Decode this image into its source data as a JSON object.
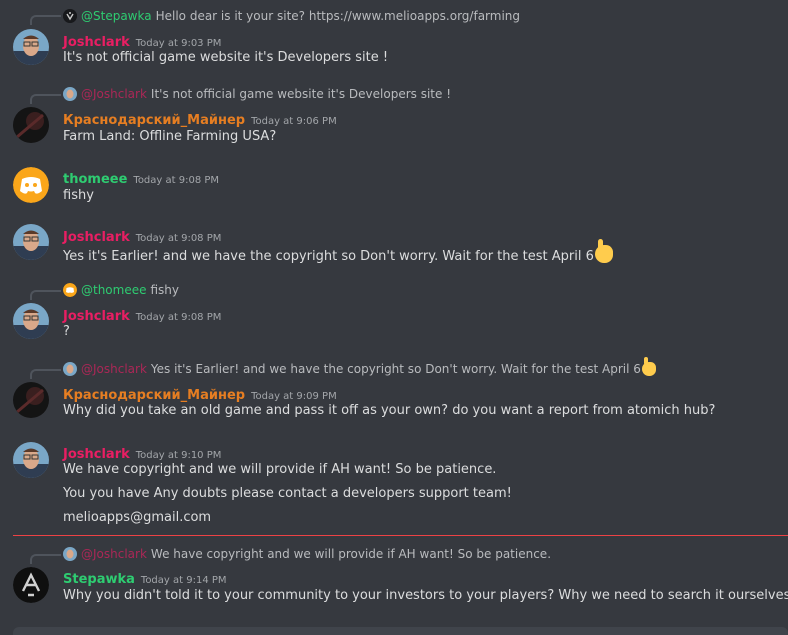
{
  "colors": {
    "background": "#36393f",
    "josh": "#e91e63",
    "krasnodar": "#e67e22",
    "thomeee": "#2ecc71",
    "stepawka": "#2ecc71",
    "new_messages_divider": "#ed4245"
  },
  "messages": [
    {
      "reply": {
        "name": "@Stepawka",
        "text": "Hello dear is it your site? https://www.melioapps.org/farming"
      },
      "author": "Joshclark",
      "time": "Today at 9:03 PM",
      "lines": [
        "It's not official game website it's Developers site !"
      ]
    },
    {
      "reply": {
        "name": "@Joshclark",
        "text": "It's not official game website it's Developers site !"
      },
      "author": "Краснодарский_Майнер",
      "time": "Today at 9:06 PM",
      "lines": [
        "Farm Land: Offline Farming USA?"
      ]
    },
    {
      "author": "thomeee",
      "time": "Today at 9:08 PM",
      "lines": [
        "fishy"
      ]
    },
    {
      "author": "Joshclark",
      "time": "Today at 9:08 PM",
      "lines": [
        "Yes it's Earlier! and we have the copyright so Don't worry. Wait for the test April 6"
      ]
    },
    {
      "reply": {
        "name": "@thomeee",
        "text": "fishy"
      },
      "author": "Joshclark",
      "time": "Today at 9:08 PM",
      "lines": [
        "?"
      ]
    },
    {
      "reply": {
        "name": "@Joshclark",
        "text": "Yes it's Earlier! and we have the copyright so Don't worry. Wait for the test April 6"
      },
      "author": "Краснодарский_Майнер",
      "time": "Today at 9:09 PM",
      "lines": [
        "Why did you take an old game and pass it off as your own? do you want a report from atomich hub?"
      ]
    },
    {
      "author": "Joshclark",
      "time": "Today at 9:10 PM",
      "lines": [
        "We have copyright and we will provide if AH want! So be patience.",
        "You you have Any doubts please contact a developers support team!",
        "melioapps@gmail.com"
      ]
    },
    {
      "reply": {
        "name": "@Joshclark",
        "text": "We have copyright and we will provide if AH want! So be patience."
      },
      "author": "Stepawka",
      "time": "Today at 9:14 PM",
      "lines": [
        "Why you didn't told it to your community to your investors to your players? Why we need to search it ourselves?"
      ]
    }
  ]
}
